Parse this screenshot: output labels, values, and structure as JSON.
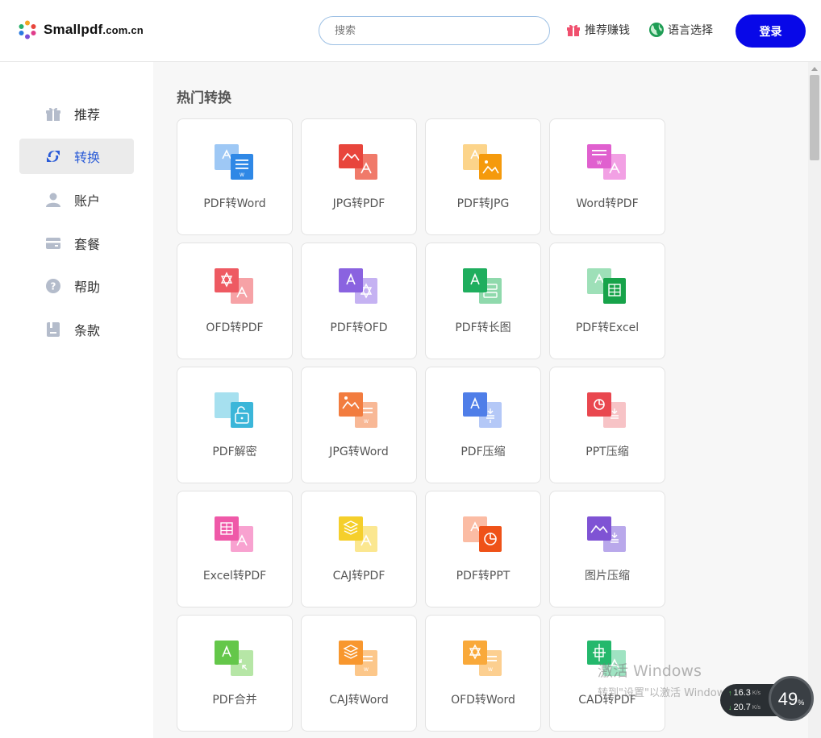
{
  "header": {
    "logo_text": "Smallpdf",
    "logo_suffix": ".com.cn",
    "search_placeholder": "搜索",
    "refer_label": "推荐赚钱",
    "language_label": "语言选择",
    "login_label": "登录"
  },
  "sidebar": {
    "items": [
      {
        "label": "推荐",
        "icon": "gift-icon"
      },
      {
        "label": "转换",
        "icon": "convert-icon",
        "active": true
      },
      {
        "label": "账户",
        "icon": "user-icon"
      },
      {
        "label": "套餐",
        "icon": "card-icon"
      },
      {
        "label": "帮助",
        "icon": "help-icon"
      },
      {
        "label": "条款",
        "icon": "document-icon"
      }
    ]
  },
  "main": {
    "section_title": "热门转换",
    "tools": [
      {
        "label": "PDF转Word",
        "icon": "pdf-to-word-icon"
      },
      {
        "label": "JPG转PDF",
        "icon": "jpg-to-pdf-icon"
      },
      {
        "label": "PDF转JPG",
        "icon": "pdf-to-jpg-icon"
      },
      {
        "label": "Word转PDF",
        "icon": "word-to-pdf-icon"
      },
      {
        "label": "OFD转PDF",
        "icon": "ofd-to-pdf-icon"
      },
      {
        "label": "PDF转OFD",
        "icon": "pdf-to-ofd-icon"
      },
      {
        "label": "PDF转长图",
        "icon": "pdf-to-long-image-icon"
      },
      {
        "label": "PDF转Excel",
        "icon": "pdf-to-excel-icon"
      },
      {
        "label": "PDF解密",
        "icon": "pdf-unlock-icon"
      },
      {
        "label": "JPG转Word",
        "icon": "jpg-to-word-icon"
      },
      {
        "label": "PDF压缩",
        "icon": "pdf-compress-icon"
      },
      {
        "label": "PPT压缩",
        "icon": "ppt-compress-icon"
      },
      {
        "label": "Excel转PDF",
        "icon": "excel-to-pdf-icon"
      },
      {
        "label": "CAJ转PDF",
        "icon": "caj-to-pdf-icon"
      },
      {
        "label": "PDF转PPT",
        "icon": "pdf-to-ppt-icon"
      },
      {
        "label": "图片压缩",
        "icon": "image-compress-icon"
      },
      {
        "label": "PDF合并",
        "icon": "pdf-merge-icon"
      },
      {
        "label": "CAJ转Word",
        "icon": "caj-to-word-icon"
      },
      {
        "label": "OFD转Word",
        "icon": "ofd-to-word-icon"
      },
      {
        "label": "CAD转PDF",
        "icon": "cad-to-pdf-icon"
      }
    ]
  },
  "overlay": {
    "watermark_line1": "激活 Windows",
    "watermark_line2": "转到\"设置\"以激活 Windows。",
    "upload_speed": "16.3",
    "download_speed": "20.7",
    "speed_unit": "K/s",
    "usage_percent": "49",
    "percent_sign": "%"
  },
  "colors": {
    "accent": "#0808e8",
    "active_nav": "#2a5bd7"
  }
}
